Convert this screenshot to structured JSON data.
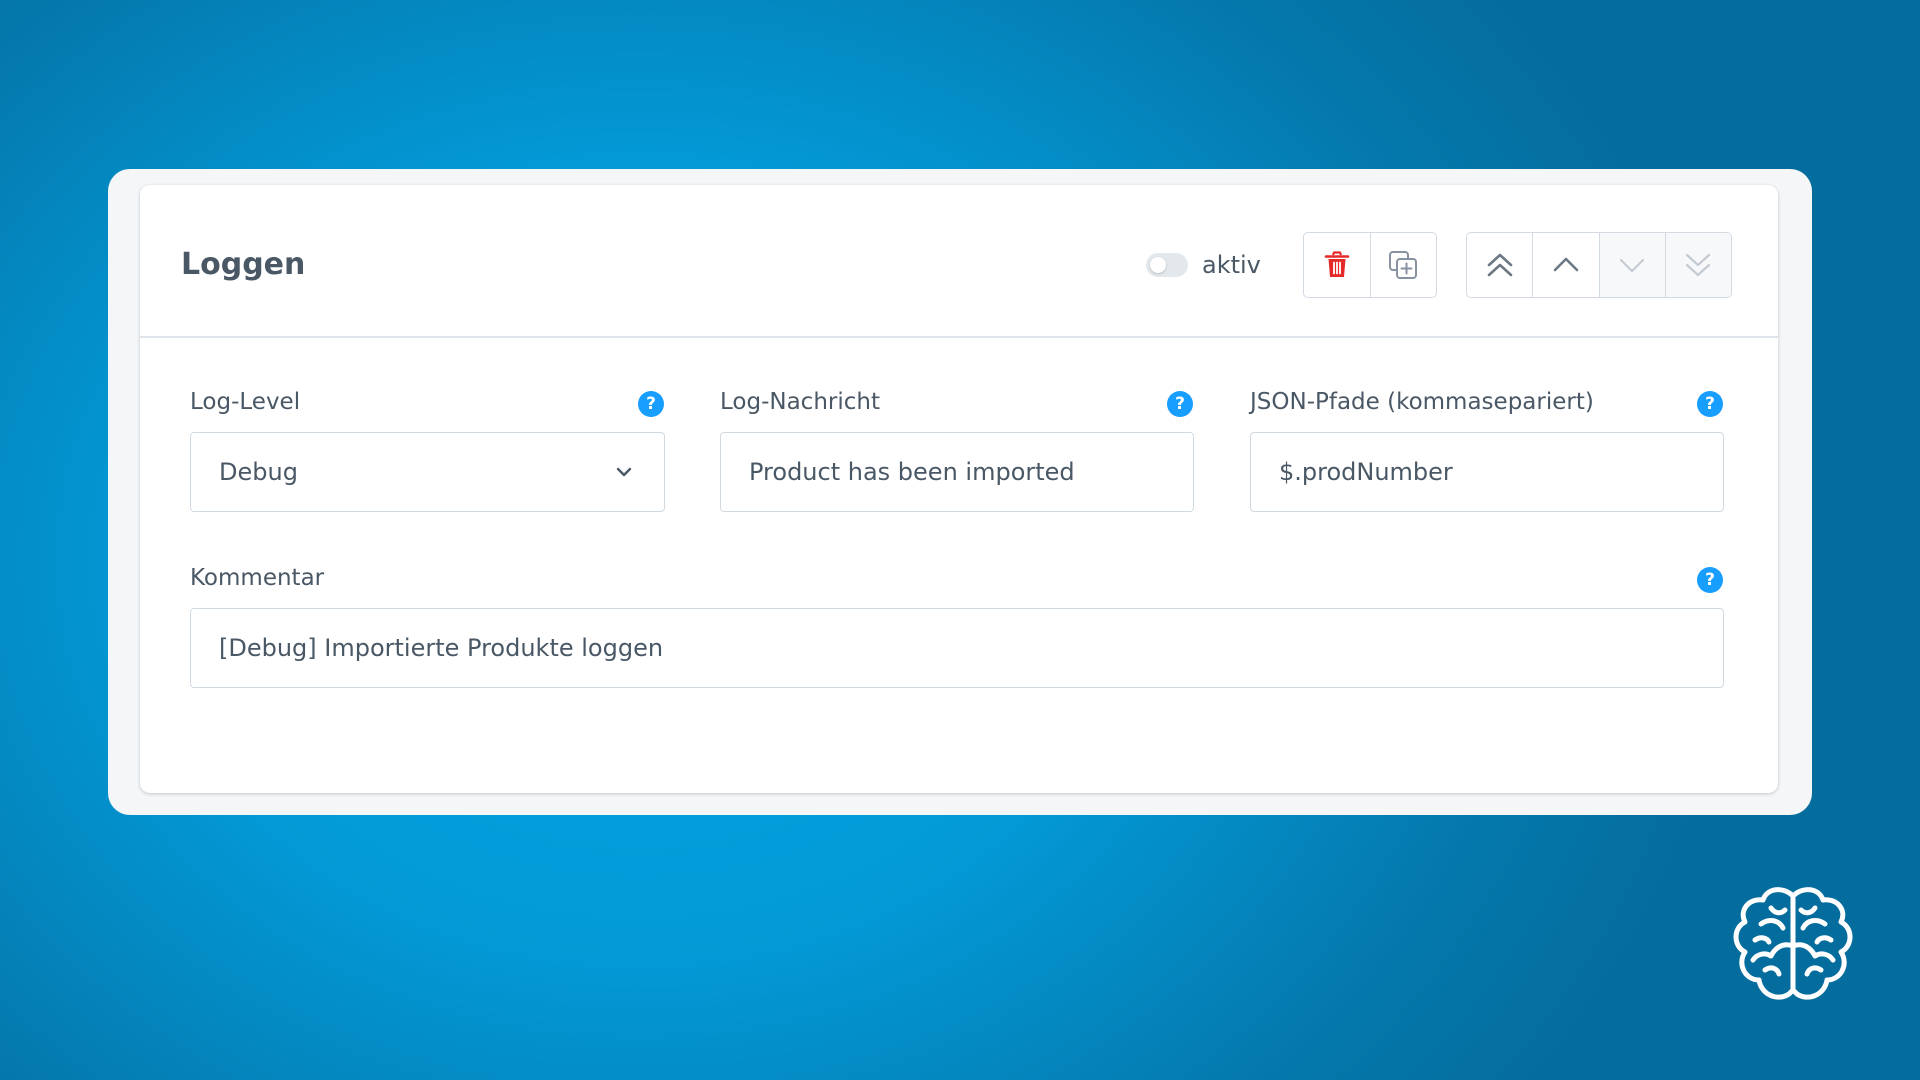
{
  "card": {
    "title": "Loggen",
    "active_label": "aktiv",
    "active": false
  },
  "toolbar": {
    "buttons": [
      {
        "icon": "trash-icon",
        "color": "#e52a2a"
      },
      {
        "icon": "duplicate-icon"
      },
      {
        "icon": "move-to-top-icon"
      },
      {
        "icon": "move-up-icon"
      },
      {
        "icon": "move-down-icon",
        "disabled": true
      },
      {
        "icon": "move-to-bottom-icon",
        "disabled": true
      }
    ]
  },
  "fields": {
    "log_level": {
      "label": "Log-Level",
      "value": "Debug"
    },
    "log_message": {
      "label": "Log-Nachricht",
      "value": "Product has been imported"
    },
    "json_paths": {
      "label": "JSON-Pfade (kommasepariert)",
      "value": "$.prodNumber"
    },
    "comment": {
      "label": "Kommentar",
      "value": "[Debug] Importierte Produkte loggen"
    }
  },
  "help_icon_glyph": "?",
  "colors": {
    "accent": "#189eff",
    "danger": "#e52a2a",
    "text": "#4a5866"
  }
}
